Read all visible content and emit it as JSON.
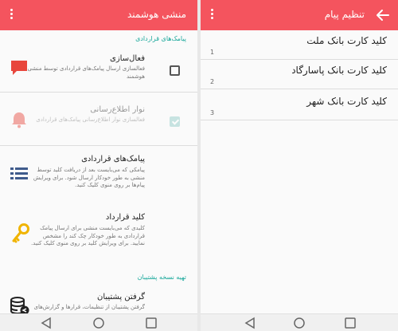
{
  "left_screen": {
    "title": "منشی هوشمند",
    "section_contract": "پیامک‌های قراردادی",
    "section_backup": "تهیه نسخه پشتیبان",
    "prefs": [
      {
        "title": "فعال‌سازی",
        "summary": "فعالسازی ارسال پیامک‌های قراردادی توسط منشی هوشمند",
        "checked": false,
        "enabled": true
      },
      {
        "title": "نوار اطلاع‌رسانی",
        "summary": "فعالسازی نوار اطلاع‌رسانی پیامک‌های قراردادی",
        "checked": true,
        "enabled": false
      },
      {
        "title": "پیامک‌های قراردادی",
        "summary": "پیامکی که می‌بایست بعد از دریافت کلید توسط منشی به طور خودکار ارسال شود. برای ویرایش پیام‌ها بر روی منوی کلیک کنید."
      },
      {
        "title": "کلید قرارداد",
        "summary": "کلیدی که می‌بایست منشی برای ارسال پیامک قراردادی به طور خودکار چک کند را مشخص نمایید. برای ویرایش کلید بر روی منوی کلیک کنید."
      },
      {
        "title": "گرفتن پشتیبان",
        "summary": "گرفتن پشتیبان از تنظیمات، قرارها و گزارش‌های"
      }
    ]
  },
  "right_screen": {
    "title": "تنظیم پیام",
    "items": [
      {
        "text": "کلید کارت بانک ملت",
        "number": "1"
      },
      {
        "text": "کلید کارت بانک پاسارگاد",
        "number": "2"
      },
      {
        "text": "کلید کارت بانک شهر",
        "number": "3"
      }
    ]
  },
  "colors": {
    "appbar": "#f4545e",
    "accent": "#1aa89b",
    "icon_red": "#e8463c",
    "icon_yellow": "#f0b400",
    "list_icon": "#3f5b8c"
  },
  "icons": [
    "more-vert-icon",
    "back-arrow-icon",
    "message-bubble-icon",
    "bell-icon",
    "list-icon",
    "key-icon",
    "database-backup-icon",
    "nav-back-icon",
    "nav-home-icon",
    "nav-recents-icon"
  ]
}
